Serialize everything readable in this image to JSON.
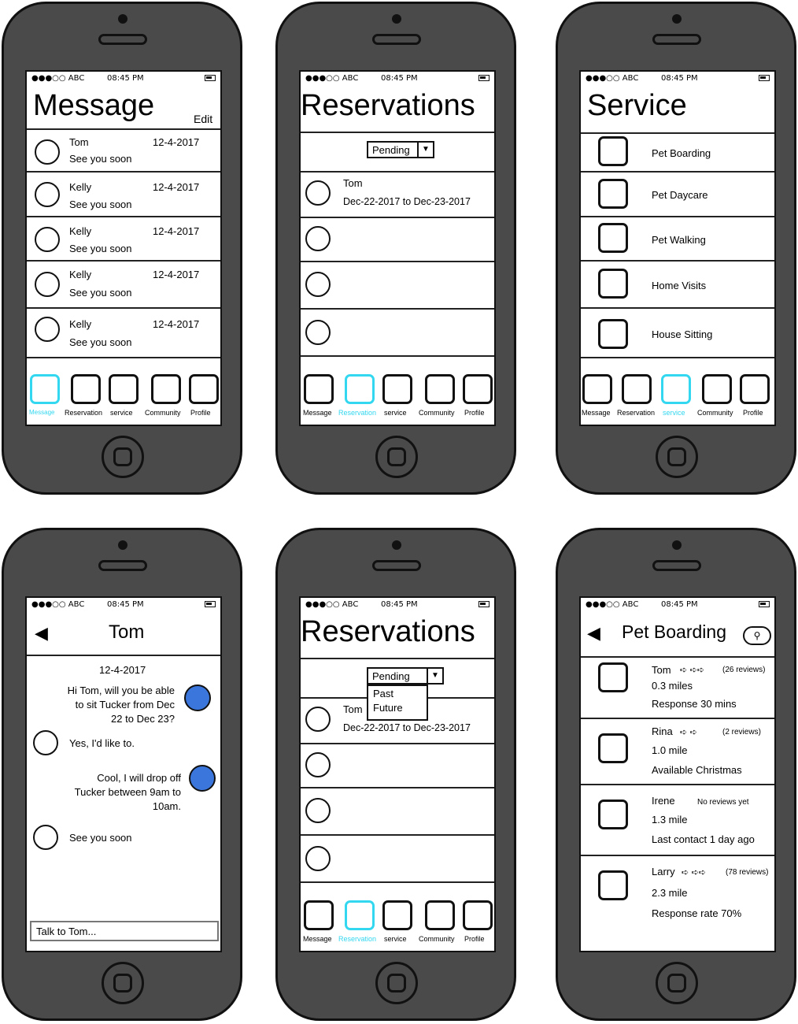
{
  "status": {
    "carrier": "●●●○○ ABC",
    "time": "08:45 PM"
  },
  "tabs": [
    "Message",
    "Reservation",
    "service",
    "Community",
    "Profile"
  ],
  "accent": "#33d7ef",
  "message_screen": {
    "title": "Message",
    "edit_label": "Edit",
    "items": [
      {
        "name": "Tom",
        "date": "12-4-2017",
        "preview": "See you soon"
      },
      {
        "name": "Kelly",
        "date": "12-4-2017",
        "preview": "See you soon"
      },
      {
        "name": "Kelly",
        "date": "12-4-2017",
        "preview": "See you soon"
      },
      {
        "name": "Kelly",
        "date": "12-4-2017",
        "preview": "See you soon"
      },
      {
        "name": "Kelly",
        "date": "12-4-2017",
        "preview": "See you soon"
      }
    ]
  },
  "reservations_screen": {
    "title": "Reservations",
    "filter_value": "Pending",
    "items": [
      {
        "name": "Tom",
        "dates": "Dec-22-2017 to Dec-23-2017"
      }
    ]
  },
  "service_screen": {
    "title": "Service",
    "items": [
      "Pet Boarding",
      "Pet Daycare",
      "Pet Walking",
      "Home Visits",
      "House Sitting"
    ]
  },
  "chat_screen": {
    "title": "Tom",
    "date": "12-4-2017",
    "messages": [
      {
        "from": "me",
        "lines": [
          "Hi Tom, will you be able",
          "to sit Tucker from Dec",
          "22 to Dec 23?"
        ]
      },
      {
        "from": "them",
        "lines": [
          "Yes, I'd like to."
        ]
      },
      {
        "from": "me",
        "lines": [
          "Cool, I will drop off",
          "Tucker between 9am to",
          "10am."
        ]
      },
      {
        "from": "them",
        "lines": [
          "See you soon"
        ]
      }
    ],
    "input_placeholder": "Talk to Tom..."
  },
  "reservations_dropdown_screen": {
    "title": "Reservations",
    "filter_value": "Pending",
    "options": [
      "Past",
      "Future"
    ],
    "item": {
      "name": "Tom",
      "dates": "Dec-22-2017 to Dec-23-2017"
    }
  },
  "boarding_screen": {
    "title": "Pet Boarding",
    "sitters": [
      {
        "name": "Tom",
        "paws": "➪ ➪➪",
        "reviews": "(26 reviews)",
        "distance": "0.3 miles",
        "note": "Response 30 mins"
      },
      {
        "name": "Rina",
        "paws": "➪ ➪",
        "reviews": "(2 reviews)",
        "distance": "1.0 mile",
        "note": "Available Christmas"
      },
      {
        "name": "Irene",
        "paws": "",
        "reviews": "No reviews yet",
        "distance": "1.3 mile",
        "note": "Last contact 1 day ago"
      },
      {
        "name": "Larry",
        "paws": "➪ ➪➪",
        "reviews": "(78 reviews)",
        "distance": "2.3 mile",
        "note": "Response rate 70%"
      }
    ]
  }
}
